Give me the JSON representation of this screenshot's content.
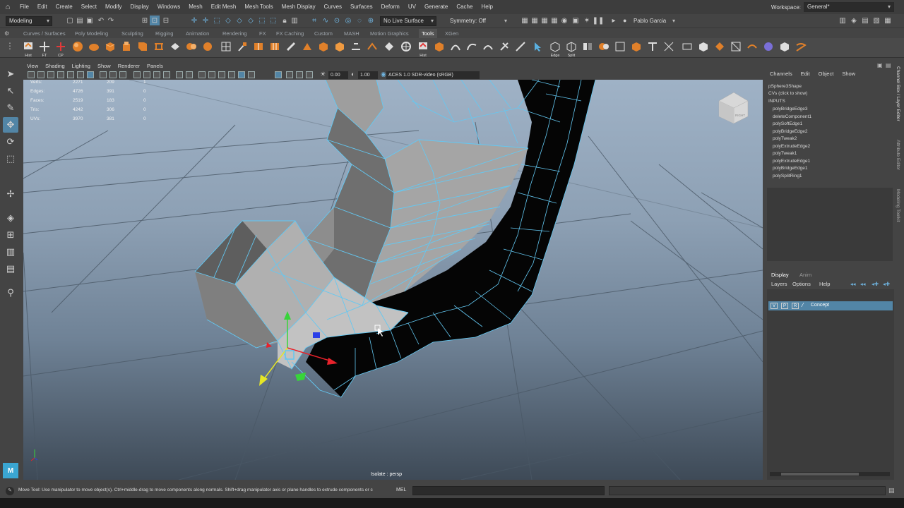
{
  "menubar": {
    "items": [
      "File",
      "Edit",
      "Create",
      "Select",
      "Modify",
      "Display",
      "Windows",
      "Mesh",
      "Edit Mesh",
      "Mesh Tools",
      "Mesh Display",
      "Curves",
      "Surfaces",
      "Deform",
      "UV",
      "Generate",
      "Cache",
      "Help"
    ],
    "workspace_label": "Workspace:",
    "workspace_value": "General*"
  },
  "statusline": {
    "menuset": "Modeling",
    "live_surface": "No Live Surface",
    "symmetry": "Symmetry: Off",
    "user": "Pablo Garcia"
  },
  "shelf": {
    "tabs": [
      "Curves / Surfaces",
      "Poly Modeling",
      "Sculpting",
      "Rigging",
      "Animation",
      "Rendering",
      "FX",
      "FX Caching",
      "Custom",
      "MASH",
      "Motion Graphics",
      "Tools",
      "XGen"
    ],
    "active_tab": "Tools",
    "icon_labels": [
      "Hist",
      "FT",
      "CP",
      "Hist",
      "Edge",
      "Split"
    ]
  },
  "panel": {
    "menu": [
      "View",
      "Shading",
      "Lighting",
      "Show",
      "Renderer",
      "Panels"
    ],
    "exposure": "0.00",
    "gamma": "1.00",
    "color_space": "ACES 1.0 SDR-video (sRGB)"
  },
  "hud": {
    "rows": [
      {
        "label": "Verts:",
        "a": "2271",
        "b": "209",
        "c": "1"
      },
      {
        "label": "Edges:",
        "a": "4726",
        "b": "391",
        "c": "0"
      },
      {
        "label": "Faces:",
        "a": "2519",
        "b": "183",
        "c": "0"
      },
      {
        "label": "Tris:",
        "a": "4242",
        "b": "306",
        "c": "0"
      },
      {
        "label": "UVs:",
        "a": "3970",
        "b": "381",
        "c": "0"
      }
    ],
    "isolate": "Isolate : persp",
    "viewcube": "RIGHT"
  },
  "channelbox": {
    "menu": [
      "Channels",
      "Edit",
      "Object",
      "Show"
    ],
    "object": "pSphere3Shape",
    "cvs": "CVs (click to show)",
    "inputs_label": "INPUTS",
    "inputs": [
      "polyBridgeEdge3",
      "deleteComponent1",
      "polySoftEdge1",
      "polyBridgeEdge2",
      "polyTweak2",
      "polyExtrudeEdge2",
      "polyTweak1",
      "polyExtrudeEdge1",
      "polyBridgeEdge1",
      "polySplitRing1"
    ]
  },
  "sidetabs": [
    "Channel Box / Layer Editor",
    "Attribute Editor",
    "Modeling Toolkit"
  ],
  "layers": {
    "tabs": [
      "Display",
      "Anim"
    ],
    "menu": [
      "Layers",
      "Options",
      "Help"
    ],
    "row": {
      "v": "V",
      "p": "P",
      "r": "R",
      "name": "Concept"
    }
  },
  "helpline": {
    "text": "Move Tool: Use manipulator to move object(s). Ctrl+middle-drag to move components along normals. Shift+drag manipulator axis or plane handles to extrude components or c",
    "mel": "MEL"
  },
  "colors": {
    "accent": "#5285a6",
    "wire": "#63c8f2",
    "manip_x": "#e8222b",
    "manip_y": "#38d43a",
    "manip_z": "#2a3fe8",
    "manip_plane": "#e6e626"
  }
}
